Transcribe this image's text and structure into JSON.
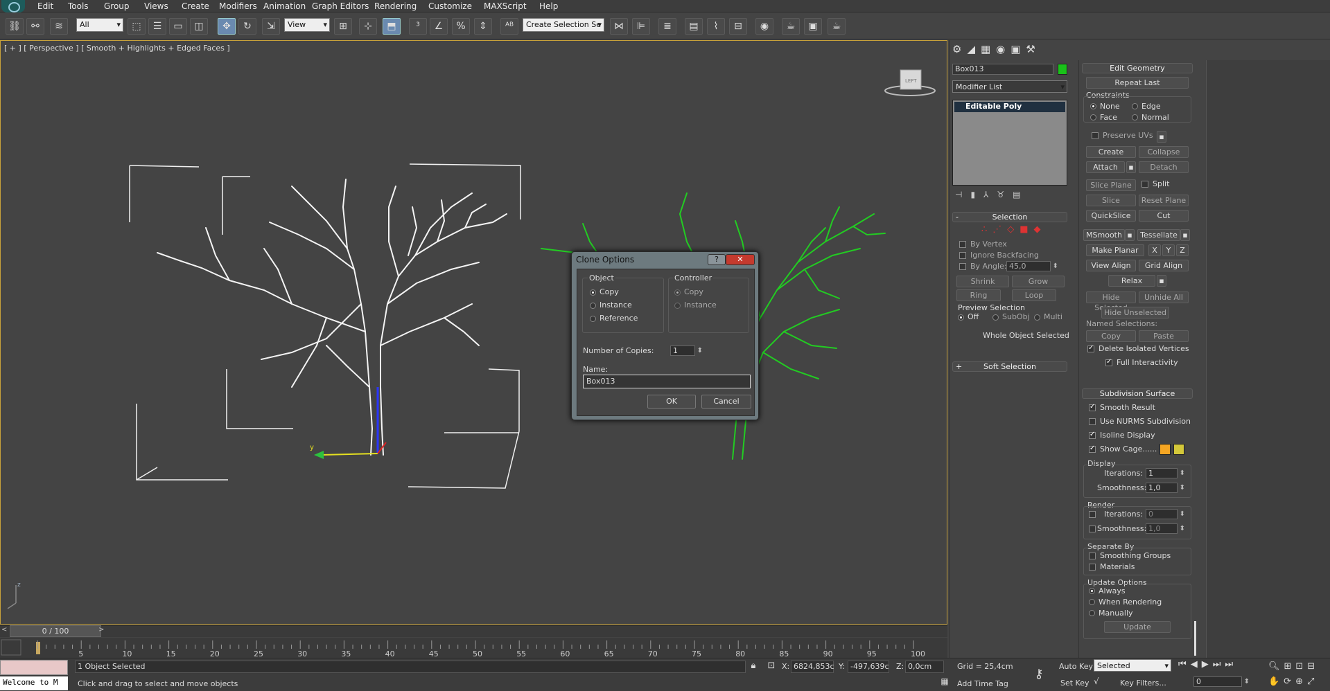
{
  "menu": [
    "Edit",
    "Tools",
    "Group",
    "Views",
    "Create",
    "Modifiers",
    "Animation",
    "Graph Editors",
    "Rendering",
    "Customize",
    "MAXScript",
    "Help"
  ],
  "toolbar": {
    "filter": "All",
    "coord": "View",
    "selection_set": "Create Selection Se"
  },
  "viewport": {
    "label": "[ + ] [ Perspective ] [ Smooth + Highlights + Edged Faces ]",
    "axis_y": "y",
    "axis_z": "z"
  },
  "dialog": {
    "title": "Clone Options",
    "object_label": "Object",
    "object_options": [
      "Copy",
      "Instance",
      "Reference"
    ],
    "controller_label": "Controller",
    "controller_options": [
      "Copy",
      "Instance"
    ],
    "copies_label": "Number of Copies:",
    "copies_value": "1",
    "name_label": "Name:",
    "name_value": "Box013",
    "ok": "OK",
    "cancel": "Cancel",
    "help_icon": "?",
    "close_icon": "✕"
  },
  "timeline": {
    "position": "0 / 100",
    "ticks": [
      "5",
      "10",
      "15",
      "20",
      "25",
      "30",
      "35",
      "40",
      "45",
      "50",
      "55",
      "60",
      "65",
      "70",
      "75",
      "80",
      "85",
      "90",
      "95",
      "100"
    ]
  },
  "status": {
    "welcome": "Welcome to M",
    "selected": "1 Object Selected",
    "prompt": "Click and drag to select and move objects",
    "x_label": "X:",
    "x": "6824,853c",
    "y_label": "Y:",
    "y": "-497,639c",
    "z_label": "Z:",
    "z": "0,0cm",
    "grid": "Grid = 25,4cm",
    "add_time_tag": "Add Time Tag",
    "auto_key": "Auto Key",
    "set_key": "Set Key",
    "key_mode": "Selected",
    "key_filters": "Key Filters...",
    "frame": "0"
  },
  "cmd": {
    "object_name": "Box013",
    "object_color": "#19c219",
    "modifier_list": "Modifier List",
    "stack_item": "Editable Poly",
    "selection_hdr": "Selection",
    "by_vertex": "By Vertex",
    "ignore_backfacing": "Ignore Backfacing",
    "by_angle": "By Angle:",
    "angle": "45,0",
    "shrink": "Shrink",
    "grow": "Grow",
    "ring": "Ring",
    "loop": "Loop",
    "preview_selection": "Preview Selection",
    "off": "Off",
    "subobj": "SubObj",
    "multi": "Multi",
    "whole_object": "Whole Object Selected",
    "soft_selection": "Soft Selection",
    "minus": "-",
    "plus": "+"
  },
  "edit_geometry": {
    "hdr": "Edit Geometry",
    "repeat_last": "Repeat Last",
    "constraints": "Constraints",
    "none": "None",
    "edge": "Edge",
    "face": "Face",
    "normal": "Normal",
    "preserve_uvs": "Preserve UVs",
    "create": "Create",
    "collapse": "Collapse",
    "attach": "Attach",
    "detach": "Detach",
    "slice_plane": "Slice Plane",
    "split": "Split",
    "slice": "Slice",
    "reset_plane": "Reset Plane",
    "quickslice": "QuickSlice",
    "cut": "Cut",
    "msmooth": "MSmooth",
    "tessellate": "Tessellate",
    "make_planar": "Make Planar",
    "x": "X",
    "y": "Y",
    "z": "Z",
    "view_align": "View Align",
    "grid_align": "Grid Align",
    "relax": "Relax",
    "hide_selected": "Hide Selected",
    "unhide_all": "Unhide All",
    "hide_unselected": "Hide Unselected",
    "named_selections": "Named Selections:",
    "copy": "Copy",
    "paste": "Paste",
    "delete_isolated": "Delete Isolated Vertices",
    "full_interactivity": "Full Interactivity"
  },
  "subdivision": {
    "hdr": "Subdivision Surface",
    "smooth_result": "Smooth Result",
    "use_nurms": "Use NURMS Subdivision",
    "isoline": "Isoline Display",
    "show_cage": "Show Cage......",
    "display": "Display",
    "iterations": "Iterations:",
    "iter_val": "1",
    "smoothness": "Smoothness:",
    "smooth_val": "1,0",
    "render": "Render",
    "r_iter_val": "0",
    "r_smooth_val": "1,0",
    "separate_by": "Separate By",
    "smoothing_groups": "Smoothing Groups",
    "materials": "Materials",
    "update_options": "Update Options",
    "always": "Always",
    "when_rendering": "When Rendering",
    "manually": "Manually",
    "update": "Update",
    "cage_color1": "#f5a623",
    "cage_color2": "#d4c83a"
  }
}
